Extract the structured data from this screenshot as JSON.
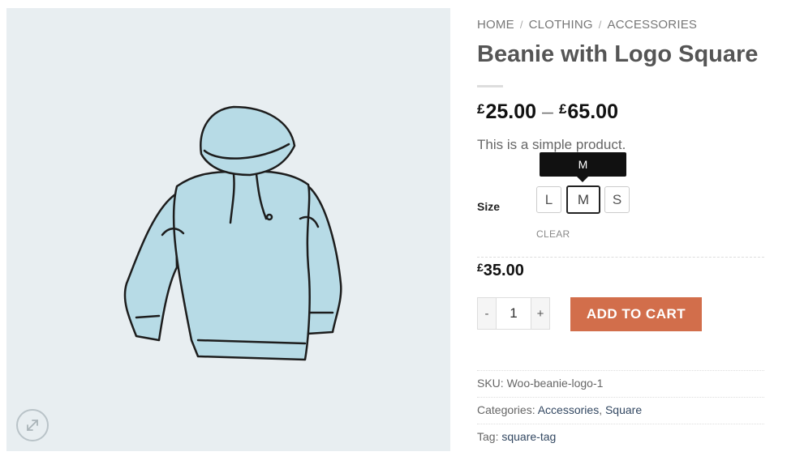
{
  "breadcrumb": {
    "items": [
      "HOME",
      "CLOTHING",
      "ACCESSORIES"
    ],
    "separator": "/"
  },
  "product": {
    "title": "Beanie with Logo Square",
    "price_range": {
      "currency": "£",
      "min": "25.00",
      "dash": "–",
      "max": "65.00"
    },
    "description": "This is a simple product."
  },
  "variations": {
    "size_label": "Size",
    "options": [
      "L",
      "M",
      "S"
    ],
    "selected": "M",
    "tooltip": "M",
    "clear_label": "CLEAR"
  },
  "variation_price": {
    "currency": "£",
    "amount": "35.00"
  },
  "cart": {
    "qty_minus": "-",
    "qty_value": "1",
    "qty_plus": "+",
    "add_label": "ADD TO CART"
  },
  "meta": {
    "sku_label": "SKU:",
    "sku_value": "Woo-beanie-logo-1",
    "categories_label": "Categories:",
    "categories": [
      "Accessories",
      "Square"
    ],
    "categories_sep": ",",
    "tag_label": "Tag:",
    "tag_value": "square-tag"
  },
  "colors": {
    "accent": "#d26e4b",
    "gallery_bg": "#e8eef1",
    "link": "#334862",
    "hoodie": "#b7dbe6"
  },
  "icons": {
    "zoom": "expand-arrows-icon"
  }
}
